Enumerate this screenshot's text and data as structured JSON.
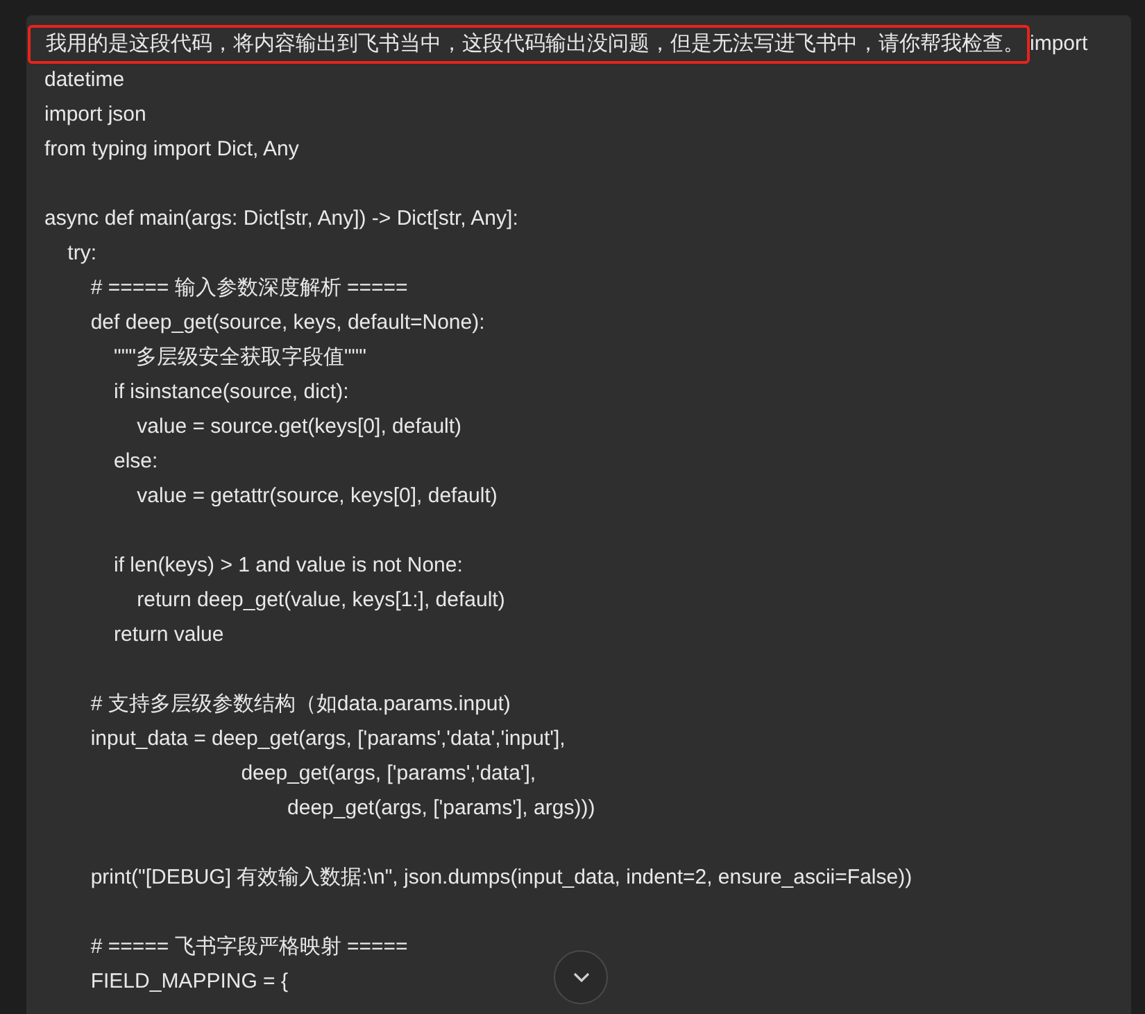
{
  "message": {
    "highlighted_text": "我用的是这段代码，将内容输出到飞书当中，这段代码输出没问题，但是无法写进飞书中，请你帮我检查。",
    "first_line_rest": "import",
    "code_blocks": [
      [
        "datetime",
        "import json",
        "from typing import Dict, Any"
      ],
      [
        "async def main(args: Dict[str, Any]) -> Dict[str, Any]:",
        "    try:",
        "        # ===== 输入参数深度解析 =====",
        "        def deep_get(source, keys, default=None):",
        "            \"\"\"多层级安全获取字段值\"\"\"",
        "            if isinstance(source, dict):",
        "                value = source.get(keys[0], default)",
        "            else:",
        "                value = getattr(source, keys[0], default)"
      ],
      [
        "            if len(keys) > 1 and value is not None:",
        "                return deep_get(value, keys[1:], default)",
        "            return value"
      ],
      [
        "        # 支持多层级参数结构（如data.params.input)",
        "        input_data = deep_get(args, ['params','data','input'],",
        "                                  deep_get(args, ['params','data'],",
        "                                          deep_get(args, ['params'], args)))"
      ],
      [
        "        print(\"[DEBUG] 有效输入数据:\\n\", json.dumps(input_data, indent=2, ensure_ascii=False))"
      ],
      [
        "        # ===== 飞书字段严格映射 =====",
        "        FIELD_MAPPING = {"
      ]
    ]
  }
}
